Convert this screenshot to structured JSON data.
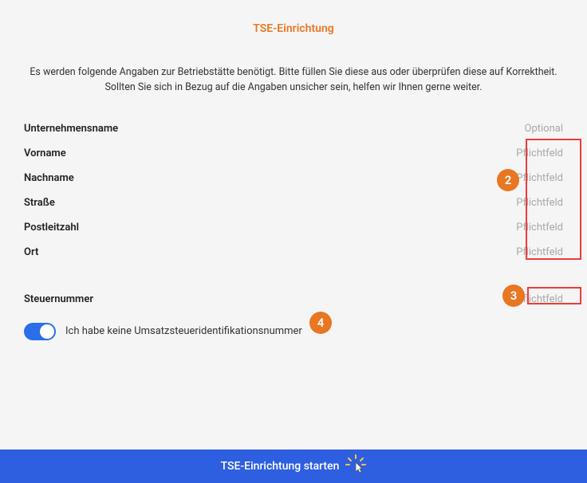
{
  "header": {
    "title": "TSE-Einrichtung"
  },
  "intro": "Es werden folgende Angaben zur Betriebstätte benötigt. Bitte füllen Sie diese aus oder überprüfen diese auf Korrektheit. Sollten Sie sich in Bezug auf die Angaben unsicher sein, helfen wir Ihnen gerne weiter.",
  "fields": {
    "company": {
      "label": "Unternehmensname",
      "placeholder": "Optional"
    },
    "firstname": {
      "label": "Vorname",
      "placeholder": "Pflichtfeld"
    },
    "lastname": {
      "label": "Nachname",
      "placeholder": "Pflichtfeld"
    },
    "street": {
      "label": "Straße",
      "placeholder": "Pflichtfeld"
    },
    "zip": {
      "label": "Postleitzahl",
      "placeholder": "Pflichtfeld"
    },
    "city": {
      "label": "Ort",
      "placeholder": "Pflichtfeld"
    },
    "taxnumber": {
      "label": "Steuernummer",
      "placeholder": "Pflichtfeld"
    }
  },
  "toggle": {
    "label": "Ich habe keine Umsatzsteueridentifikationsnummer",
    "on": true
  },
  "footer": {
    "button": "TSE-Einrichtung starten"
  },
  "annotations": {
    "badge2": "2",
    "badge3": "3",
    "badge4": "4"
  }
}
